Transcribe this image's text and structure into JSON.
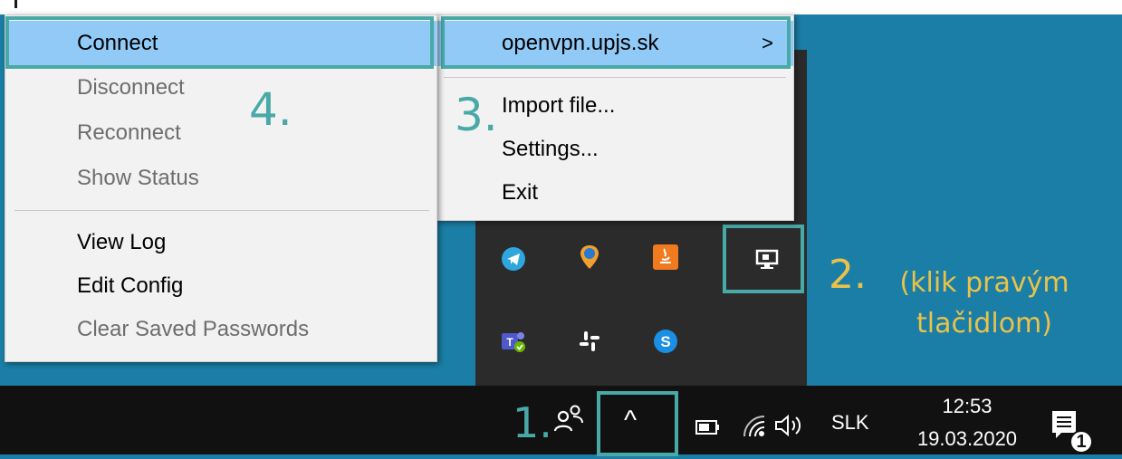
{
  "context_menu": {
    "items": [
      {
        "label": "Connect",
        "state": "highlighted"
      },
      {
        "label": "Disconnect",
        "state": "disabled"
      },
      {
        "label": "Reconnect",
        "state": "disabled"
      },
      {
        "label": "Show Status",
        "state": "disabled"
      },
      {
        "label": "View Log",
        "state": "enabled"
      },
      {
        "label": "Edit Config",
        "state": "enabled"
      },
      {
        "label": "Clear Saved Passwords",
        "state": "disabled"
      }
    ]
  },
  "main_menu": {
    "server": "openvpn.upjs.sk",
    "submenu_arrow": ">",
    "items": [
      "Import file...",
      "Settings...",
      "Exit"
    ]
  },
  "annotations": {
    "step1": "1.",
    "step2": "2.",
    "step2_note": "(klik pravým\ntlačidlom)",
    "step3": "3.",
    "step4": "4."
  },
  "taskbar": {
    "language": "SLK",
    "time": "12:53",
    "date": "19.03.2020",
    "notification_count": "1",
    "show_hidden_glyph": "^"
  },
  "tray_icons": [
    "telegram-icon",
    "location-icon",
    "java-icon",
    "openvpn-icon",
    "teams-icon",
    "slack-icon",
    "skype-icon"
  ],
  "colors": {
    "desktop": "#1b7ea6",
    "taskbar": "#111111",
    "highlight": "#91c9f7",
    "annotation_teal": "#48a9a6",
    "annotation_gold": "#e9c24a"
  }
}
